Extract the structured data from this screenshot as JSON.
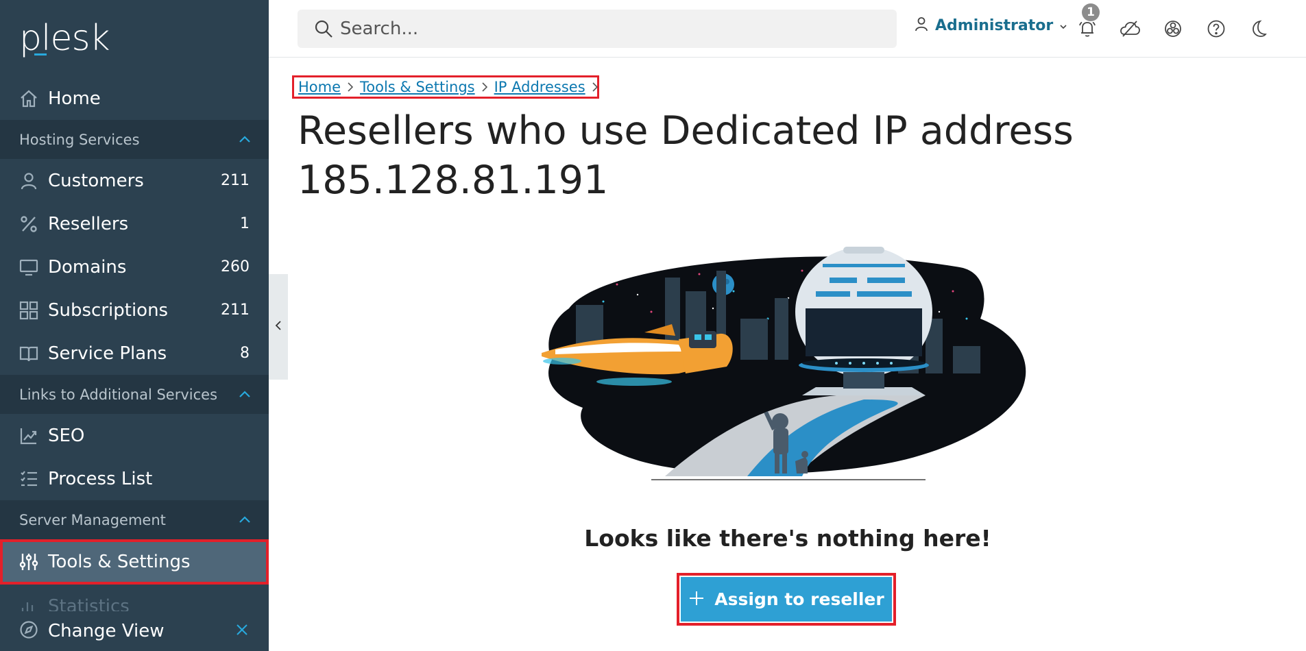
{
  "app": {
    "logo": "plesk"
  },
  "sidebar": {
    "home": "Home",
    "sections": [
      {
        "label": "Hosting Services"
      },
      {
        "label": "Links to Additional Services"
      },
      {
        "label": "Server Management"
      }
    ],
    "hosting_items": [
      {
        "label": "Customers",
        "count": "211",
        "icon": "user-icon"
      },
      {
        "label": "Resellers",
        "count": "1",
        "icon": "percent-icon"
      },
      {
        "label": "Domains",
        "count": "260",
        "icon": "monitor-icon"
      },
      {
        "label": "Subscriptions",
        "count": "211",
        "icon": "grid-icon"
      },
      {
        "label": "Service Plans",
        "count": "8",
        "icon": "book-icon"
      }
    ],
    "links_items": [
      {
        "label": "SEO",
        "icon": "chart-icon"
      },
      {
        "label": "Process List",
        "icon": "list-icon"
      }
    ],
    "server_items": [
      {
        "label": "Tools & Settings",
        "icon": "sliders-icon",
        "active": true
      },
      {
        "label": "Statistics",
        "icon": "bar-chart-icon"
      }
    ],
    "change_view": "Change View"
  },
  "header": {
    "search_placeholder": "Search...",
    "user": "Administrator",
    "notification_count": "1"
  },
  "breadcrumb": [
    {
      "label": "Home"
    },
    {
      "label": "Tools & Settings"
    },
    {
      "label": "IP Addresses"
    }
  ],
  "page": {
    "title_line1": "Resellers who use Dedicated IP address",
    "title_line2": "185.128.81.191",
    "empty_message": "Looks like there's nothing here!",
    "assign_button": "Assign to reseller"
  },
  "colors": {
    "sidebar_bg": "#2c4150",
    "section_bg": "#243643",
    "active_bg": "#4f6779",
    "accent": "#2ea0d4",
    "link": "#0c78b0",
    "highlight": "#e3202a"
  }
}
